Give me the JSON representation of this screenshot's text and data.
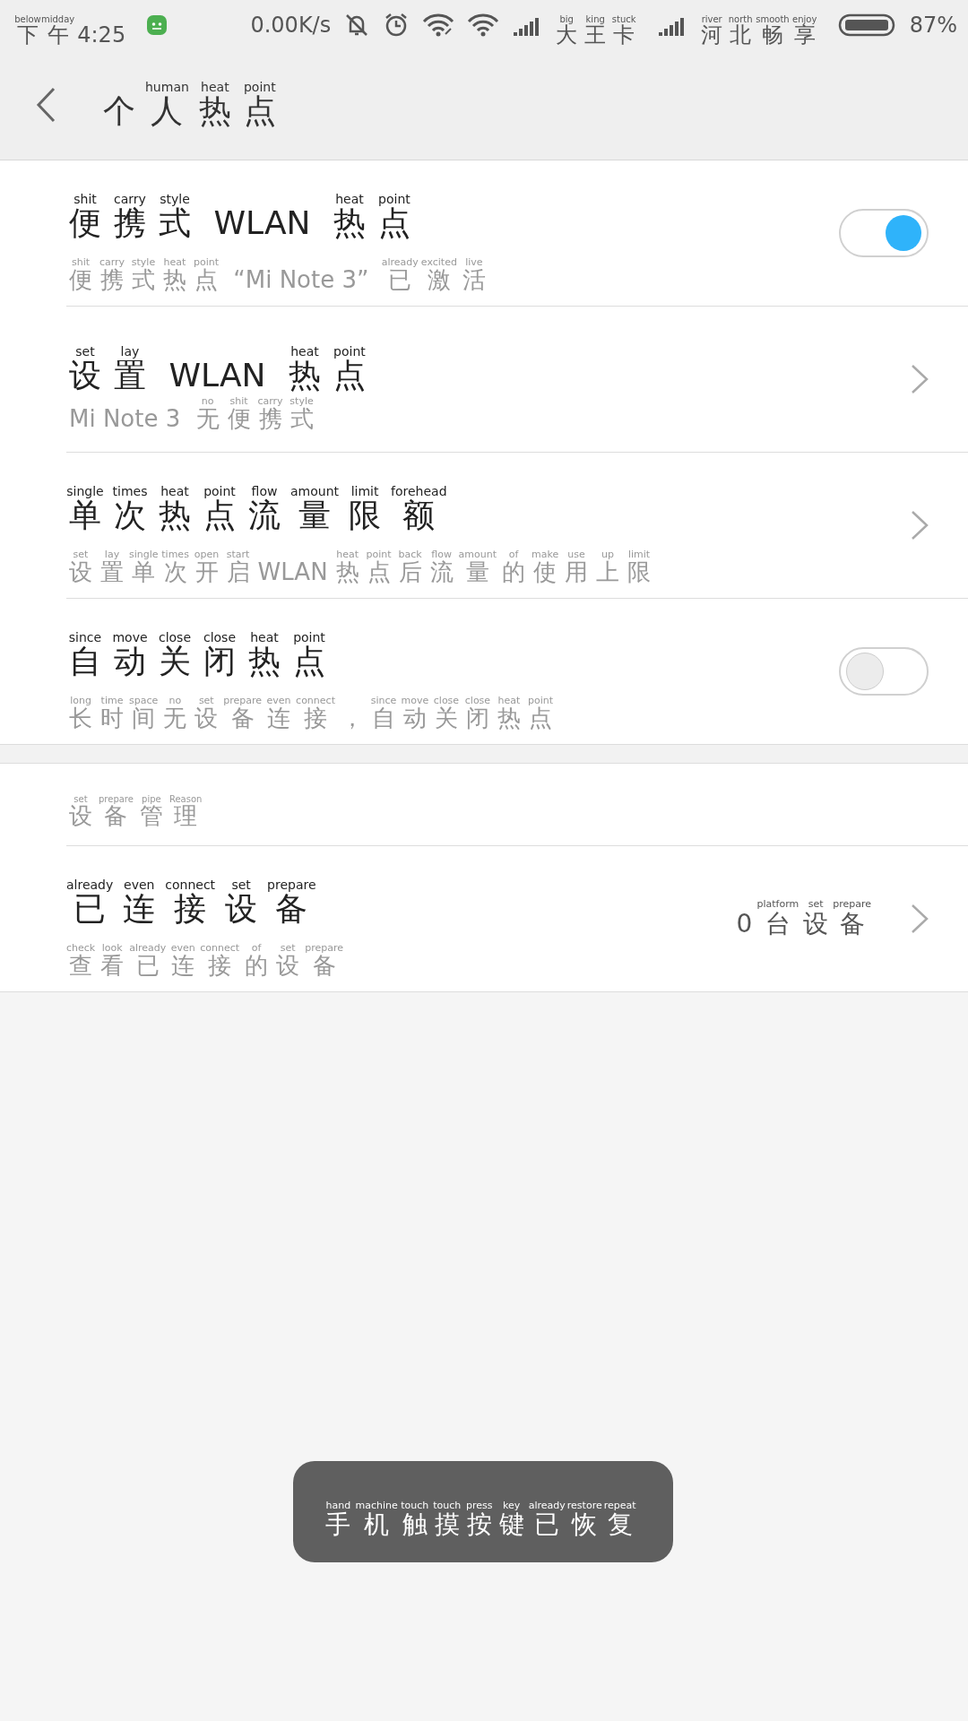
{
  "status_bar": {
    "time": [
      [
        "below",
        "下"
      ],
      [
        "midday",
        "午"
      ],
      [
        "4:25"
      ]
    ],
    "speed": "0.00K/s",
    "carriers": [
      [
        [
          "big",
          "大"
        ],
        [
          "king",
          "王"
        ],
        [
          "stuck",
          "卡"
        ]
      ],
      [
        [
          "river",
          "河"
        ],
        [
          "north",
          "北"
        ],
        [
          "smooth",
          "畅"
        ],
        [
          "enjoy",
          "享"
        ]
      ]
    ],
    "battery": "87%"
  },
  "header": {
    "title": [
      [
        "个"
      ],
      [
        "human",
        "人"
      ],
      [
        "heat",
        "热"
      ],
      [
        "point",
        "点"
      ]
    ]
  },
  "settings": [
    {
      "kind": "toggle",
      "on": true,
      "title": [
        [
          "shit",
          "便"
        ],
        [
          "carry",
          "携"
        ],
        [
          "style",
          "式"
        ],
        [
          " WLAN "
        ],
        [
          "heat",
          "热"
        ],
        [
          "point",
          "点"
        ]
      ],
      "subtitle": [
        [
          "shit",
          "便"
        ],
        [
          "carry",
          "携"
        ],
        [
          "style",
          "式"
        ],
        [
          "heat",
          "热"
        ],
        [
          "point",
          "点"
        ],
        [
          " “Mi Note 3” "
        ],
        [
          "already",
          "已"
        ],
        [
          "excited",
          "激"
        ],
        [
          "live",
          "活"
        ]
      ]
    },
    {
      "kind": "link",
      "title": [
        [
          "set",
          "设"
        ],
        [
          "lay",
          "置"
        ],
        [
          " WLAN "
        ],
        [
          "heat",
          "热"
        ],
        [
          "point",
          "点"
        ]
      ],
      "subtitle": [
        [
          "Mi Note 3 "
        ],
        [
          "no",
          "无"
        ],
        [
          "shit",
          "便"
        ],
        [
          "carry",
          "携"
        ],
        [
          "style",
          "式"
        ]
      ]
    },
    {
      "kind": "link",
      "title": [
        [
          "single",
          "单"
        ],
        [
          "times",
          "次"
        ],
        [
          "heat",
          "热"
        ],
        [
          "point",
          "点"
        ],
        [
          "flow",
          "流"
        ],
        [
          "amount",
          "量"
        ],
        [
          "limit",
          "限"
        ],
        [
          "forehead",
          "额"
        ]
      ],
      "subtitle": [
        [
          "set",
          "设"
        ],
        [
          "lay",
          "置"
        ],
        [
          "single",
          "单"
        ],
        [
          "times",
          "次"
        ],
        [
          "open",
          "开"
        ],
        [
          "start",
          "启"
        ],
        [
          "WLAN"
        ],
        [
          "heat",
          "热"
        ],
        [
          "point",
          "点"
        ],
        [
          "back",
          "后"
        ],
        [
          "flow",
          "流"
        ],
        [
          "amount",
          "量"
        ],
        [
          "of",
          "的"
        ],
        [
          "make",
          "使"
        ],
        [
          "use",
          "用"
        ],
        [
          "up",
          "上"
        ],
        [
          "limit",
          "限"
        ]
      ]
    },
    {
      "kind": "toggle",
      "on": false,
      "title": [
        [
          "since",
          "自"
        ],
        [
          "move",
          "动"
        ],
        [
          "close",
          "关"
        ],
        [
          "close",
          "闭"
        ],
        [
          "heat",
          "热"
        ],
        [
          "point",
          "点"
        ]
      ],
      "subtitle": [
        [
          "long",
          "长"
        ],
        [
          "time",
          "时"
        ],
        [
          "space",
          "间"
        ],
        [
          "no",
          "无"
        ],
        [
          "set",
          "设"
        ],
        [
          "prepare",
          "备"
        ],
        [
          "even",
          "连"
        ],
        [
          "connect",
          "接"
        ],
        [
          "，"
        ],
        [
          "since",
          "自"
        ],
        [
          "move",
          "动"
        ],
        [
          "close",
          "关"
        ],
        [
          "close",
          "闭"
        ],
        [
          "heat",
          "热"
        ],
        [
          "point",
          "点"
        ]
      ]
    }
  ],
  "device_section": {
    "header": [
      [
        "set",
        "设"
      ],
      [
        "prepare",
        "备"
      ],
      [
        "pipe",
        "管"
      ],
      [
        "Reason",
        "理"
      ]
    ],
    "items": [
      {
        "kind": "link",
        "title": [
          [
            "already",
            "已"
          ],
          [
            "even",
            "连"
          ],
          [
            "connect",
            "接"
          ],
          [
            "set",
            "设"
          ],
          [
            "prepare",
            "备"
          ]
        ],
        "subtitle": [
          [
            "check",
            "查"
          ],
          [
            "look",
            "看"
          ],
          [
            "already",
            "已"
          ],
          [
            "even",
            "连"
          ],
          [
            "connect",
            "接"
          ],
          [
            "of",
            "的"
          ],
          [
            "set",
            "设"
          ],
          [
            "prepare",
            "备"
          ]
        ],
        "value": [
          [
            "0"
          ],
          [
            "platform",
            "台"
          ],
          [
            "set",
            "设"
          ],
          [
            "prepare",
            "备"
          ]
        ]
      }
    ]
  },
  "toast": [
    [
      "hand",
      "手"
    ],
    [
      "machine",
      "机"
    ],
    [
      "touch",
      "触"
    ],
    [
      "touch",
      "摸"
    ],
    [
      "press",
      "按"
    ],
    [
      "key",
      "键"
    ],
    [
      "already",
      "已"
    ],
    [
      "restore",
      "恢"
    ],
    [
      "repeat",
      "复"
    ]
  ]
}
